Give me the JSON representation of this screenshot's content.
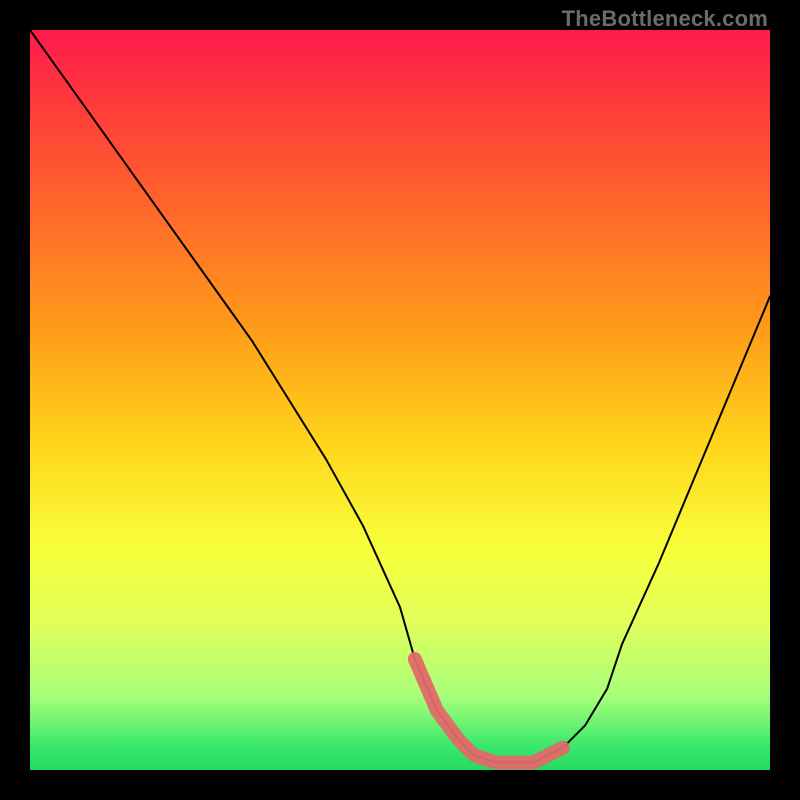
{
  "watermark": "TheBottleneck.com",
  "colors": {
    "curve_stroke": "#000000",
    "highlight": "#e06a6a",
    "background": "#000000"
  },
  "chart_data": {
    "type": "line",
    "title": "",
    "xlabel": "",
    "ylabel": "",
    "xlim": [
      0,
      100
    ],
    "ylim": [
      0,
      100
    ],
    "series": [
      {
        "name": "bottleneck-curve",
        "x": [
          0,
          5,
          10,
          15,
          20,
          25,
          30,
          35,
          40,
          45,
          50,
          52,
          55,
          58,
          60,
          63,
          65,
          68,
          70,
          72,
          75,
          78,
          80,
          85,
          90,
          95,
          100
        ],
        "y": [
          100,
          93,
          86,
          79,
          72,
          65,
          58,
          50,
          42,
          33,
          22,
          15,
          8,
          4,
          2,
          1,
          1,
          1,
          2,
          3,
          6,
          11,
          17,
          28,
          40,
          52,
          64
        ]
      }
    ],
    "highlight_segment": {
      "name": "optimal-range",
      "x": [
        52,
        55,
        58,
        60,
        63,
        65,
        68,
        70,
        72
      ],
      "y": [
        15,
        8,
        4,
        2,
        1,
        1,
        1,
        2,
        3
      ]
    }
  }
}
